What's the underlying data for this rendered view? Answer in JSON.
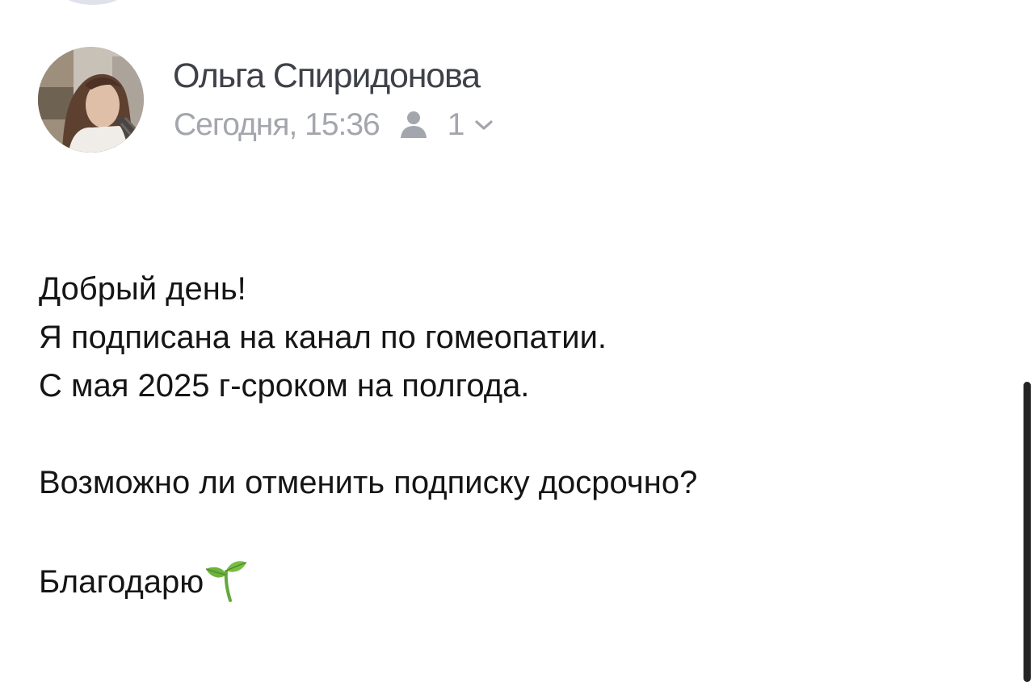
{
  "sender": {
    "name": "Ольга Спиридонова",
    "timestamp": "Сегодня, 15:36",
    "recipient_count": "1",
    "avatar_icon": "avatar-photo"
  },
  "message": {
    "lines": [
      "Добрый день!",
      "Я подписана на канал по гомеопатии.",
      "С мая 2025 г-сроком на полгода.",
      "",
      "Возможно ли отменить подписку досрочно?",
      "",
      "Благодарю"
    ],
    "closing_emoji_icon": "sprout-icon"
  },
  "colors": {
    "name": "#3f4148",
    "meta": "#a4a6ad",
    "body_text": "#151515",
    "background": "#ffffff",
    "scrollbar": "#242424"
  }
}
